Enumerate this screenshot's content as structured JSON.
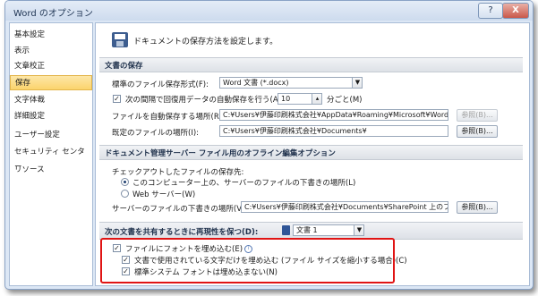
{
  "window": {
    "title": "Word のオプション",
    "help_label": "?",
    "close_label": "X"
  },
  "sidebar": {
    "items": [
      {
        "label": "基本設定"
      },
      {
        "label": "表示"
      },
      {
        "label": "文章校正"
      },
      {
        "label": "保存"
      },
      {
        "label": "文字体裁"
      },
      {
        "label": "詳細設定"
      },
      {
        "label": "ユーザー設定"
      },
      {
        "label": "セキュリティ センター"
      },
      {
        "label": "リソース"
      }
    ],
    "active_index": 3
  },
  "header": {
    "text": "ドキュメントの保存方法を設定します。"
  },
  "save_section": {
    "heading": "文書の保存",
    "format_label": "標準のファイル保存形式(F):",
    "format_value": "Word 文書 (*.docx)",
    "autorecover_label": "次の間隔で回復用データの自動保存を行う(A):",
    "autorecover_checked": true,
    "autorecover_minutes": "10",
    "autorecover_unit": "分ごと(M)",
    "autorecover_path_label": "ファイルを自動保存する場所(R):",
    "autorecover_path": "C:¥Users¥伊藤印刷株式会社¥AppData¥Roaming¥Microsoft¥Word¥",
    "default_path_label": "既定のファイルの場所(I):",
    "default_path": "C:¥Users¥伊藤印刷株式会社¥Documents¥",
    "browse_label": "参照(B)..."
  },
  "server_section": {
    "heading": "ドキュメント管理サーバー ファイル用のオフライン編集オプション",
    "checkout_label": "チェックアウトしたファイルの保存先:",
    "radio_local": "このコンピューター上の、サーバーのファイルの下書きの場所(L)",
    "radio_web": "Web サーバー(W)",
    "drafts_label": "サーバーのファイルの下書きの場所(V):",
    "drafts_path": "C:¥Users¥伊藤印刷株式会社¥Documents¥SharePoint 上のファイル¥",
    "browse_label": "参照(B)..."
  },
  "fidelity_section": {
    "heading": "次の文書を共有するときに再現性を保つ(D):",
    "document_value": "文書 1",
    "embed_fonts": "ファイルにフォントを埋め込む(E)",
    "embed_used_chars": "文書で使用されている文字だけを埋め込む (ファイル サイズを縮小する場合)(C)",
    "no_system_fonts": "標準システム フォントは埋め込まない(N)",
    "check_mark": "✓",
    "info_glyph": "i"
  }
}
